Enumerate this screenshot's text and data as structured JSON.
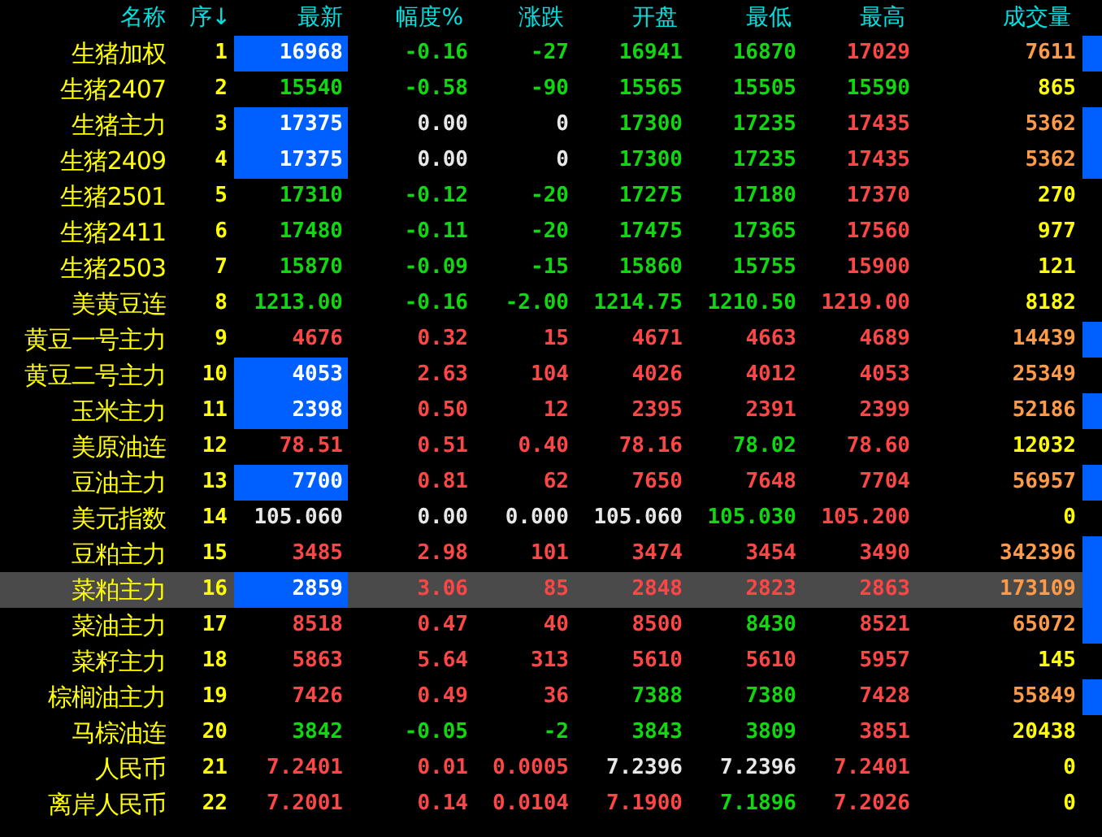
{
  "columns": [
    "名称",
    "序↓",
    "最新",
    "幅度%",
    "涨跌",
    "开盘",
    "最低",
    "最高",
    "成交量"
  ],
  "rows": [
    {
      "name": "生猪加权",
      "seq": "1",
      "selected": false,
      "marker": true,
      "flash": true,
      "cells": [
        {
          "text": "16968"
        },
        {
          "text": "-0.16",
          "kind": "down"
        },
        {
          "text": "-27",
          "kind": "down"
        },
        {
          "text": "16941",
          "kind": "down"
        },
        {
          "text": "16870",
          "kind": "down"
        },
        {
          "text": "17029",
          "kind": "up"
        },
        {
          "text": "7611",
          "kind": "heavy"
        }
      ]
    },
    {
      "name": "生猪2407",
      "seq": "2",
      "selected": false,
      "marker": false,
      "flash": false,
      "cells": [
        {
          "text": "15540",
          "kind": "down"
        },
        {
          "text": "-0.58",
          "kind": "down"
        },
        {
          "text": "-90",
          "kind": "down"
        },
        {
          "text": "15565",
          "kind": "down"
        },
        {
          "text": "15505",
          "kind": "down"
        },
        {
          "text": "15590",
          "kind": "down"
        },
        {
          "text": "865",
          "kind": "light"
        }
      ]
    },
    {
      "name": "生猪主力",
      "seq": "3",
      "selected": false,
      "marker": true,
      "flash": true,
      "cells": [
        {
          "text": "17375"
        },
        {
          "text": "0.00",
          "kind": "flat"
        },
        {
          "text": "0",
          "kind": "flat"
        },
        {
          "text": "17300",
          "kind": "down"
        },
        {
          "text": "17235",
          "kind": "down"
        },
        {
          "text": "17435",
          "kind": "up"
        },
        {
          "text": "5362",
          "kind": "heavy"
        }
      ]
    },
    {
      "name": "生猪2409",
      "seq": "4",
      "selected": false,
      "marker": true,
      "flash": true,
      "cells": [
        {
          "text": "17375"
        },
        {
          "text": "0.00",
          "kind": "flat"
        },
        {
          "text": "0",
          "kind": "flat"
        },
        {
          "text": "17300",
          "kind": "down"
        },
        {
          "text": "17235",
          "kind": "down"
        },
        {
          "text": "17435",
          "kind": "up"
        },
        {
          "text": "5362",
          "kind": "heavy"
        }
      ]
    },
    {
      "name": "生猪2501",
      "seq": "5",
      "selected": false,
      "marker": false,
      "flash": false,
      "cells": [
        {
          "text": "17310",
          "kind": "down"
        },
        {
          "text": "-0.12",
          "kind": "down"
        },
        {
          "text": "-20",
          "kind": "down"
        },
        {
          "text": "17275",
          "kind": "down"
        },
        {
          "text": "17180",
          "kind": "down"
        },
        {
          "text": "17370",
          "kind": "up"
        },
        {
          "text": "270",
          "kind": "light"
        }
      ]
    },
    {
      "name": "生猪2411",
      "seq": "6",
      "selected": false,
      "marker": false,
      "flash": false,
      "cells": [
        {
          "text": "17480",
          "kind": "down"
        },
        {
          "text": "-0.11",
          "kind": "down"
        },
        {
          "text": "-20",
          "kind": "down"
        },
        {
          "text": "17475",
          "kind": "down"
        },
        {
          "text": "17365",
          "kind": "down"
        },
        {
          "text": "17560",
          "kind": "up"
        },
        {
          "text": "977",
          "kind": "light"
        }
      ]
    },
    {
      "name": "生猪2503",
      "seq": "7",
      "selected": false,
      "marker": false,
      "flash": false,
      "cells": [
        {
          "text": "15870",
          "kind": "down"
        },
        {
          "text": "-0.09",
          "kind": "down"
        },
        {
          "text": "-15",
          "kind": "down"
        },
        {
          "text": "15860",
          "kind": "down"
        },
        {
          "text": "15755",
          "kind": "down"
        },
        {
          "text": "15900",
          "kind": "up"
        },
        {
          "text": "121",
          "kind": "light"
        }
      ]
    },
    {
      "name": "美黄豆连",
      "seq": "8",
      "selected": false,
      "marker": false,
      "flash": false,
      "cells": [
        {
          "text": "1213.00",
          "kind": "down"
        },
        {
          "text": "-0.16",
          "kind": "down"
        },
        {
          "text": "-2.00",
          "kind": "down"
        },
        {
          "text": "1214.75",
          "kind": "down"
        },
        {
          "text": "1210.50",
          "kind": "down"
        },
        {
          "text": "1219.00",
          "kind": "up"
        },
        {
          "text": "8182",
          "kind": "light"
        }
      ]
    },
    {
      "name": "黄豆一号主力",
      "seq": "9",
      "selected": false,
      "marker": true,
      "flash": false,
      "cells": [
        {
          "text": "4676",
          "kind": "up"
        },
        {
          "text": "0.32",
          "kind": "up"
        },
        {
          "text": "15",
          "kind": "up"
        },
        {
          "text": "4671",
          "kind": "up"
        },
        {
          "text": "4663",
          "kind": "up"
        },
        {
          "text": "4689",
          "kind": "up"
        },
        {
          "text": "14439",
          "kind": "heavy"
        }
      ]
    },
    {
      "name": "黄豆二号主力",
      "seq": "10",
      "selected": false,
      "marker": false,
      "flash": true,
      "cells": [
        {
          "text": "4053"
        },
        {
          "text": "2.63",
          "kind": "up"
        },
        {
          "text": "104",
          "kind": "up"
        },
        {
          "text": "4026",
          "kind": "up"
        },
        {
          "text": "4012",
          "kind": "up"
        },
        {
          "text": "4053",
          "kind": "up"
        },
        {
          "text": "25349",
          "kind": "heavy"
        }
      ]
    },
    {
      "name": "玉米主力",
      "seq": "11",
      "selected": false,
      "marker": true,
      "flash": true,
      "cells": [
        {
          "text": "2398"
        },
        {
          "text": "0.50",
          "kind": "up"
        },
        {
          "text": "12",
          "kind": "up"
        },
        {
          "text": "2395",
          "kind": "up"
        },
        {
          "text": "2391",
          "kind": "up"
        },
        {
          "text": "2399",
          "kind": "up"
        },
        {
          "text": "52186",
          "kind": "heavy"
        }
      ]
    },
    {
      "name": "美原油连",
      "seq": "12",
      "selected": false,
      "marker": false,
      "flash": false,
      "cells": [
        {
          "text": "78.51",
          "kind": "up"
        },
        {
          "text": "0.51",
          "kind": "up"
        },
        {
          "text": "0.40",
          "kind": "up"
        },
        {
          "text": "78.16",
          "kind": "up"
        },
        {
          "text": "78.02",
          "kind": "down"
        },
        {
          "text": "78.60",
          "kind": "up"
        },
        {
          "text": "12032",
          "kind": "light"
        }
      ]
    },
    {
      "name": "豆油主力",
      "seq": "13",
      "selected": false,
      "marker": true,
      "flash": true,
      "cells": [
        {
          "text": "7700"
        },
        {
          "text": "0.81",
          "kind": "up"
        },
        {
          "text": "62",
          "kind": "up"
        },
        {
          "text": "7650",
          "kind": "up"
        },
        {
          "text": "7648",
          "kind": "up"
        },
        {
          "text": "7704",
          "kind": "up"
        },
        {
          "text": "56957",
          "kind": "heavy"
        }
      ]
    },
    {
      "name": "美元指数",
      "seq": "14",
      "selected": false,
      "marker": false,
      "flash": false,
      "cells": [
        {
          "text": "105.060",
          "kind": "flat"
        },
        {
          "text": "0.00",
          "kind": "flat"
        },
        {
          "text": "0.000",
          "kind": "flat"
        },
        {
          "text": "105.060",
          "kind": "flat"
        },
        {
          "text": "105.030",
          "kind": "down"
        },
        {
          "text": "105.200",
          "kind": "up"
        },
        {
          "text": "0",
          "kind": "light"
        }
      ]
    },
    {
      "name": "豆粕主力",
      "seq": "15",
      "selected": false,
      "marker": true,
      "flash": false,
      "cells": [
        {
          "text": "3485",
          "kind": "up"
        },
        {
          "text": "2.98",
          "kind": "up"
        },
        {
          "text": "101",
          "kind": "up"
        },
        {
          "text": "3474",
          "kind": "up"
        },
        {
          "text": "3454",
          "kind": "up"
        },
        {
          "text": "3490",
          "kind": "up"
        },
        {
          "text": "342396",
          "kind": "heavy"
        }
      ]
    },
    {
      "name": "菜粕主力",
      "seq": "16",
      "selected": true,
      "marker": true,
      "flash": true,
      "cells": [
        {
          "text": "2859"
        },
        {
          "text": "3.06",
          "kind": "up"
        },
        {
          "text": "85",
          "kind": "up"
        },
        {
          "text": "2848",
          "kind": "up"
        },
        {
          "text": "2823",
          "kind": "up"
        },
        {
          "text": "2863",
          "kind": "up"
        },
        {
          "text": "173109",
          "kind": "heavy"
        }
      ]
    },
    {
      "name": "菜油主力",
      "seq": "17",
      "selected": false,
      "marker": true,
      "flash": false,
      "cells": [
        {
          "text": "8518",
          "kind": "up"
        },
        {
          "text": "0.47",
          "kind": "up"
        },
        {
          "text": "40",
          "kind": "up"
        },
        {
          "text": "8500",
          "kind": "up"
        },
        {
          "text": "8430",
          "kind": "down"
        },
        {
          "text": "8521",
          "kind": "up"
        },
        {
          "text": "65072",
          "kind": "heavy"
        }
      ]
    },
    {
      "name": "菜籽主力",
      "seq": "18",
      "selected": false,
      "marker": false,
      "flash": false,
      "cells": [
        {
          "text": "5863",
          "kind": "up"
        },
        {
          "text": "5.64",
          "kind": "up"
        },
        {
          "text": "313",
          "kind": "up"
        },
        {
          "text": "5610",
          "kind": "up"
        },
        {
          "text": "5610",
          "kind": "up"
        },
        {
          "text": "5957",
          "kind": "up"
        },
        {
          "text": "145",
          "kind": "light"
        }
      ]
    },
    {
      "name": "棕榈油主力",
      "seq": "19",
      "selected": false,
      "marker": true,
      "flash": false,
      "cells": [
        {
          "text": "7426",
          "kind": "up"
        },
        {
          "text": "0.49",
          "kind": "up"
        },
        {
          "text": "36",
          "kind": "up"
        },
        {
          "text": "7388",
          "kind": "down"
        },
        {
          "text": "7380",
          "kind": "down"
        },
        {
          "text": "7428",
          "kind": "up"
        },
        {
          "text": "55849",
          "kind": "heavy"
        }
      ]
    },
    {
      "name": "马棕油连",
      "seq": "20",
      "selected": false,
      "marker": false,
      "flash": false,
      "cells": [
        {
          "text": "3842",
          "kind": "down"
        },
        {
          "text": "-0.05",
          "kind": "down"
        },
        {
          "text": "-2",
          "kind": "down"
        },
        {
          "text": "3843",
          "kind": "down"
        },
        {
          "text": "3809",
          "kind": "down"
        },
        {
          "text": "3851",
          "kind": "up"
        },
        {
          "text": "20438",
          "kind": "light"
        }
      ]
    },
    {
      "name": "人民币",
      "seq": "21",
      "selected": false,
      "marker": false,
      "flash": false,
      "cells": [
        {
          "text": "7.2401",
          "kind": "up"
        },
        {
          "text": "0.01",
          "kind": "up"
        },
        {
          "text": "0.0005",
          "kind": "up"
        },
        {
          "text": "7.2396",
          "kind": "flat"
        },
        {
          "text": "7.2396",
          "kind": "flat"
        },
        {
          "text": "7.2401",
          "kind": "up"
        },
        {
          "text": "0",
          "kind": "light"
        }
      ]
    },
    {
      "name": "离岸人民币",
      "seq": "22",
      "selected": false,
      "marker": false,
      "flash": false,
      "cells": [
        {
          "text": "7.2001",
          "kind": "up"
        },
        {
          "text": "0.14",
          "kind": "up"
        },
        {
          "text": "0.0104",
          "kind": "up"
        },
        {
          "text": "7.1900",
          "kind": "up"
        },
        {
          "text": "7.1896",
          "kind": "down"
        },
        {
          "text": "7.2026",
          "kind": "up"
        },
        {
          "text": "0",
          "kind": "light"
        }
      ]
    }
  ]
}
